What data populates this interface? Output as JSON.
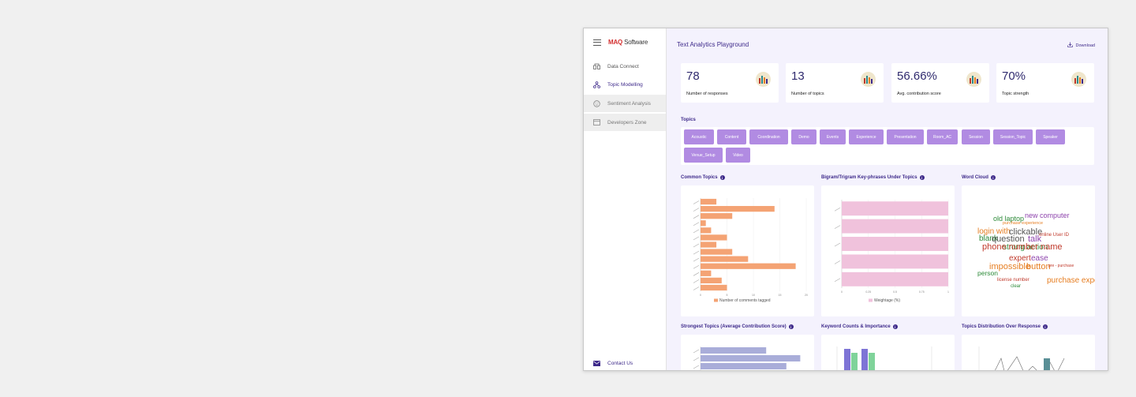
{
  "app": {
    "logo_main": "MAQ",
    "logo_sub": "Software"
  },
  "sidebar": {
    "items": [
      {
        "label": "Data Connect",
        "icon": "data-connect-icon"
      },
      {
        "label": "Topic Modelling",
        "icon": "topic-modelling-icon"
      },
      {
        "label": "Sentiment Analysis",
        "icon": "sentiment-icon"
      },
      {
        "label": "Developers Zone",
        "icon": "developers-icon"
      }
    ],
    "contact": "Contact Us"
  },
  "header": {
    "title": "Text Analytics Playground",
    "download": "Download"
  },
  "kpis": [
    {
      "value": "78",
      "label": "Number of responses"
    },
    {
      "value": "13",
      "label": "Number of topics"
    },
    {
      "value": "56.66%",
      "label": "Avg. contribution score"
    },
    {
      "value": "70%",
      "label": "Topic strength"
    }
  ],
  "colors": {
    "accent": "#3e2a8a",
    "chip": "#b18be2",
    "bar_orange": "#f4a374",
    "bar_pink": "#f0c2dc",
    "bar_blue": "#a9add9"
  },
  "topics": {
    "title": "Topics",
    "items": [
      "Acoustic",
      "Content",
      "Coordination",
      "Demo",
      "Events",
      "Experience",
      "Presentation",
      "Room_AC",
      "Session",
      "Session_Topic",
      "Speaker",
      "Venue_Setup",
      "Video"
    ]
  },
  "sections": {
    "common_topics": "Common Topics",
    "bigram": "Bigram/Trigram Key-phrases Under Topics",
    "word_cloud": "Word Cloud",
    "strongest": "Strongest Topics (Average Contribution Score)",
    "keyword_counts": "Keyword Counts & Importance",
    "distribution": "Topics Distribution Over Response"
  },
  "chart_data": [
    {
      "type": "bar",
      "title": "Common Topics",
      "orientation": "horizontal",
      "legend": "Number of comments tagged",
      "legend_position": "bottom",
      "xlim": [
        0,
        20
      ],
      "xticks": [
        "0",
        "5",
        "10",
        "15",
        "20"
      ],
      "values": [
        3,
        14,
        6,
        1,
        2,
        5,
        3,
        6,
        9,
        18,
        2,
        4,
        5
      ]
    },
    {
      "type": "bar",
      "title": "Bigram/Trigram Key-phrases Under Topics",
      "orientation": "horizontal",
      "legend": "Weightage (%)",
      "legend_position": "bottom",
      "xlim": [
        0,
        1
      ],
      "xticks": [
        "0",
        "0.25",
        "0.5",
        "0.75",
        "1"
      ],
      "values": [
        1,
        1,
        1,
        1,
        1
      ]
    },
    {
      "type": "bar",
      "title": "Strongest Topics (Average Contribution Score)",
      "orientation": "horizontal",
      "values": [
        0.52,
        0.79,
        0.68
      ]
    }
  ],
  "word_cloud": {
    "words": [
      {
        "text": "old laptop",
        "color": "#2e8b3a"
      },
      {
        "text": "new computer",
        "color": "#8e44ad"
      },
      {
        "text": "purchase experience",
        "color": "#e67e22"
      },
      {
        "text": "login with",
        "color": "#e67e22"
      },
      {
        "text": "clickable",
        "color": "#555555"
      },
      {
        "text": "online User ID",
        "color": "#c0392b"
      },
      {
        "text": "blank",
        "color": "#2e8b3a"
      },
      {
        "text": "question",
        "color": "#555555"
      },
      {
        "text": "talk",
        "color": "#8e44ad"
      },
      {
        "text": "strong action",
        "color": "#2e8b3a"
      },
      {
        "text": "phone number name",
        "color": "#c0392b"
      },
      {
        "text": "expert",
        "color": "#c0392b"
      },
      {
        "text": "ease",
        "color": "#8e44ad"
      },
      {
        "text": "impossible",
        "color": "#e67e22"
      },
      {
        "text": "button",
        "color": "#e67e22"
      },
      {
        "text": "person",
        "color": "#2e8b3a"
      },
      {
        "text": "license number",
        "color": "#c0392b"
      },
      {
        "text": "purchase experience",
        "color": "#e67e22"
      },
      {
        "text": "clear",
        "color": "#2e8b3a"
      },
      {
        "text": "pre - purchase",
        "color": "#c0392b"
      }
    ]
  }
}
